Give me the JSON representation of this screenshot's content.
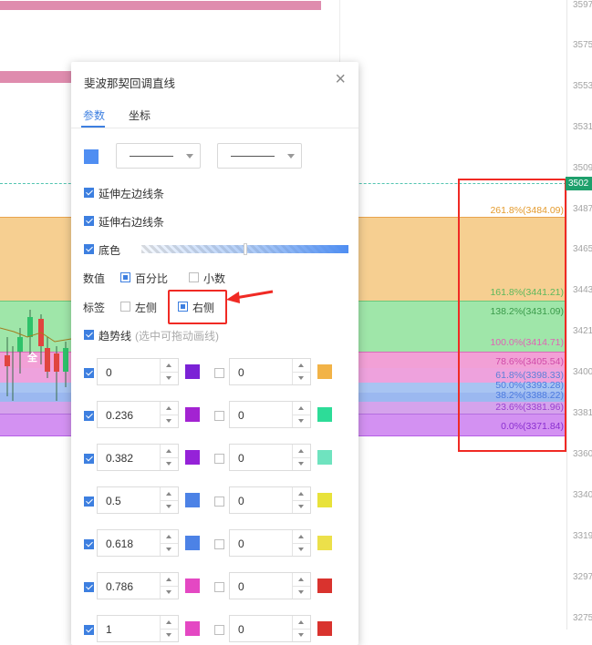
{
  "chart": {
    "axis_ticks": [
      "3597",
      "3575",
      "3553",
      "3531",
      "3509",
      "3487",
      "3465",
      "3443",
      "3421",
      "3400",
      "3381",
      "3360",
      "3340",
      "3319",
      "3297",
      "3275"
    ],
    "price_tag": "3502",
    "candle_label": "全",
    "levels": [
      {
        "label": "261.8%(3484.09)",
        "color": "#e49a2c"
      },
      {
        "label": "161.8%(3441.21)",
        "color": "#5cb85c"
      },
      {
        "label": "138.2%(3431.09)",
        "color": "#3a9a4a"
      },
      {
        "label": "100.0%(3414.71)",
        "color": "#e062b5"
      },
      {
        "label": "78.6%(3405.54)",
        "color": "#d04aa8"
      },
      {
        "label": "61.8%(3398.33)",
        "color": "#5b7fd8"
      },
      {
        "label": "50.0%(3393.28)",
        "color": "#4c7be0"
      },
      {
        "label": "38.2%(3388.22)",
        "color": "#4c7be0"
      },
      {
        "label": "23.6%(3381.96)",
        "color": "#9a3fd0"
      },
      {
        "label": "0.0%(3371.84)",
        "color": "#8a2fd0"
      }
    ]
  },
  "dialog": {
    "title": "斐波那契回调直线",
    "close_glyph": "×",
    "tabs": [
      "参数",
      "坐标"
    ],
    "line_color": "#4f8ef2",
    "extend_left": "延伸左边线条",
    "extend_right": "延伸右边线条",
    "fill_label": "底色",
    "value_label": "数值",
    "value_options": [
      "百分比",
      "小数"
    ],
    "label_label": "标签",
    "label_options": [
      "左侧",
      "右侧"
    ],
    "trend_label": "趋势线",
    "trend_hint": "(选中可拖动画线)",
    "rows": [
      {
        "left": "0",
        "left_color": "#7b22d6",
        "right": "0",
        "right_color": "#f2b347"
      },
      {
        "left": "0.236",
        "left_color": "#a323d2",
        "right": "0",
        "right_color": "#2ddc98"
      },
      {
        "left": "0.382",
        "left_color": "#9522d8",
        "right": "0",
        "right_color": "#6fe3bf"
      },
      {
        "left": "0.5",
        "left_color": "#4c82e6",
        "right": "0",
        "right_color": "#e8e23a"
      },
      {
        "left": "0.618",
        "left_color": "#4c82e6",
        "right": "0",
        "right_color": "#ece04a"
      },
      {
        "left": "0.786",
        "left_color": "#e448c3",
        "right": "0",
        "right_color": "#d9332e"
      },
      {
        "left": "1",
        "left_color": "#e448c3",
        "right": "0",
        "right_color": "#d9332e"
      }
    ]
  }
}
